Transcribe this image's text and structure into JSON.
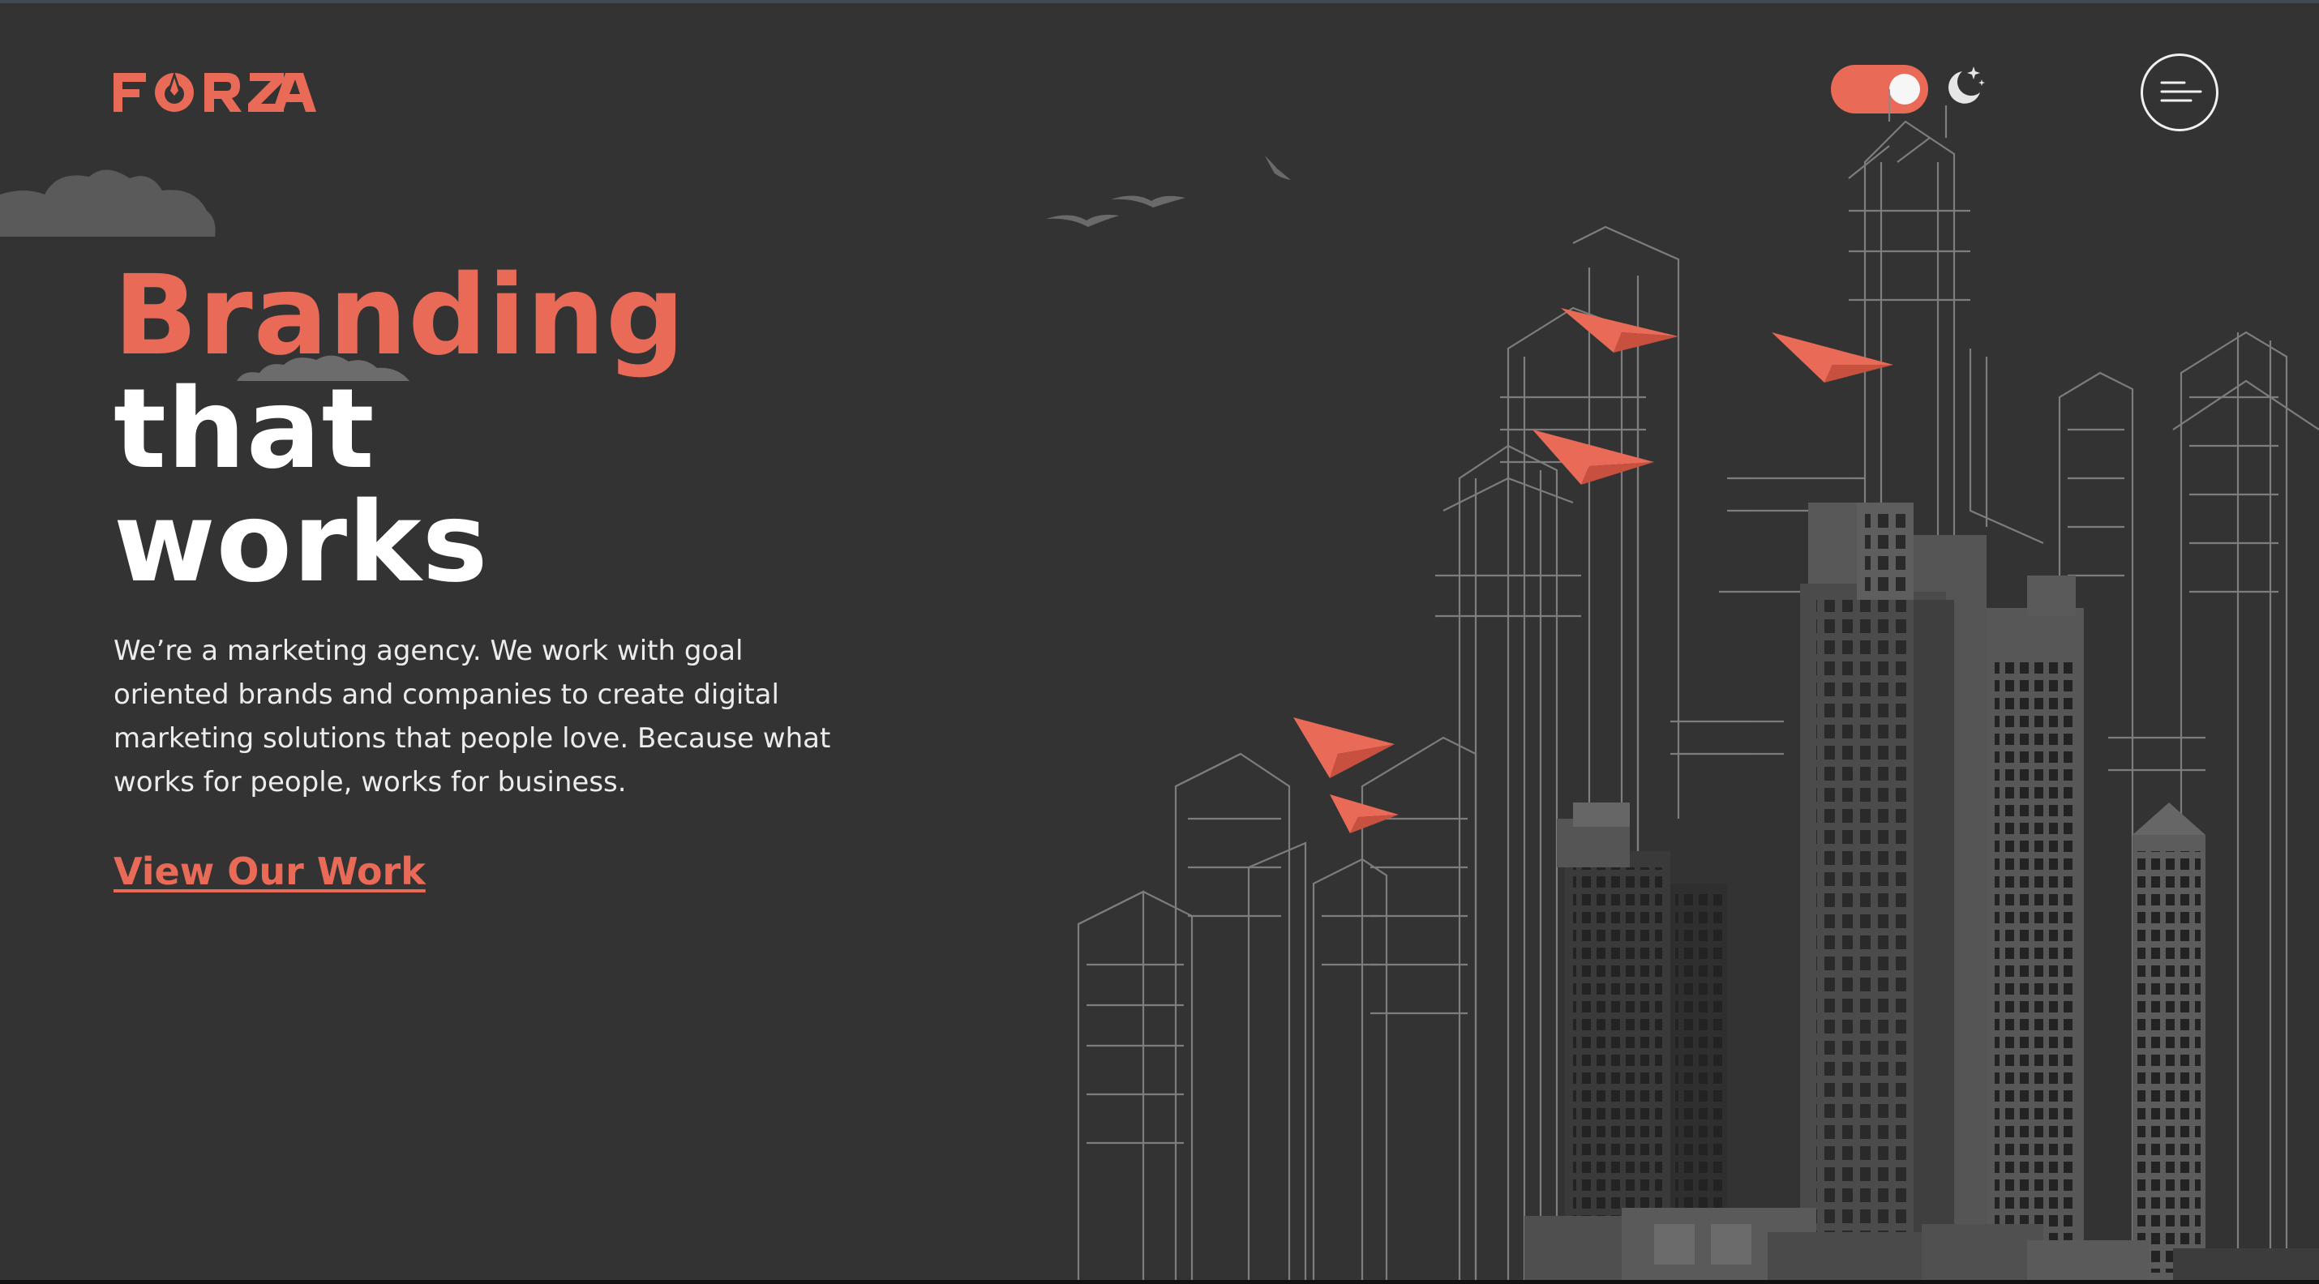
{
  "header": {
    "logo_text": "FORZA",
    "theme_toggle_state": "dark",
    "moon_icon": "moon-stars-icon",
    "menu_icon": "hamburger-menu-icon"
  },
  "hero": {
    "title_line1": "Branding",
    "title_line2": "that",
    "title_line3": "works",
    "description": "We’re a marketing agency. We work with goal oriented brands and companies to create digital marketing solutions that people love. Because what works for people, works for business.",
    "cta_label": "View Our Work"
  },
  "colors": {
    "background": "#333333",
    "accent": "#ea6a58",
    "text_primary": "#ffffff",
    "text_secondary": "#ececec"
  },
  "illustration": {
    "subject": "city-skyline-with-paper-planes"
  }
}
